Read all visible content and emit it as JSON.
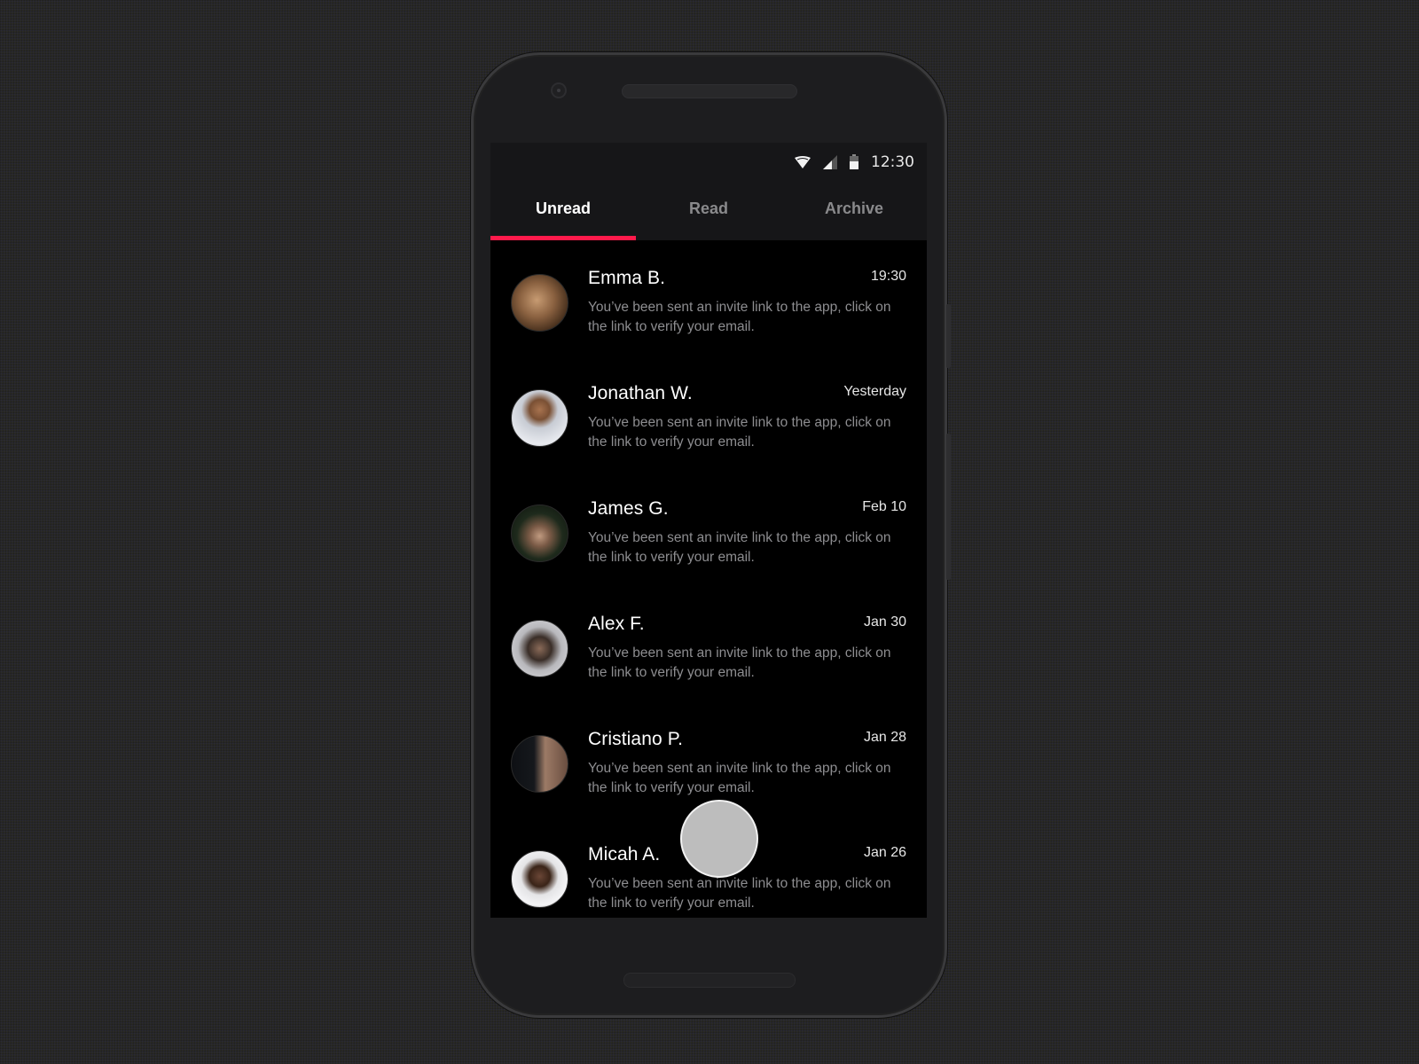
{
  "status_bar": {
    "wifi_icon": "wifi-icon",
    "signal_icon": "cell-signal-icon",
    "battery_icon": "battery-icon",
    "time": "12:30"
  },
  "tabs": [
    {
      "label": "Unread",
      "active": true
    },
    {
      "label": "Read",
      "active": false
    },
    {
      "label": "Archive",
      "active": false
    }
  ],
  "accent_color": "#ff1a4b",
  "messages": [
    {
      "name": "Emma B.",
      "time": "19:30",
      "text": "You’ve been sent an invite link to the app, click on the link to verify your email.",
      "avatar": "avatar-emma"
    },
    {
      "name": "Jonathan W.",
      "time": "Yesterday",
      "text": "You’ve been sent an invite link to the app, click on the link to verify your email.",
      "avatar": "avatar-jonathan"
    },
    {
      "name": "James G.",
      "time": "Feb 10",
      "text": "You’ve been sent an invite link to the app, click on the link to verify your email.",
      "avatar": "avatar-james"
    },
    {
      "name": "Alex F.",
      "time": "Jan 30",
      "text": "You’ve been sent an invite link to the app, click on the link to verify your email.",
      "avatar": "avatar-alex"
    },
    {
      "name": "Cristiano P.",
      "time": "Jan 28",
      "text": "You’ve been sent an invite link to the app, click on the link to verify your email.",
      "avatar": "avatar-cristiano"
    },
    {
      "name": "Micah A.",
      "time": "Jan 26",
      "text": "You’ve been sent an invite link to the app, click on the link to verify your email.",
      "avatar": "avatar-micah"
    }
  ]
}
